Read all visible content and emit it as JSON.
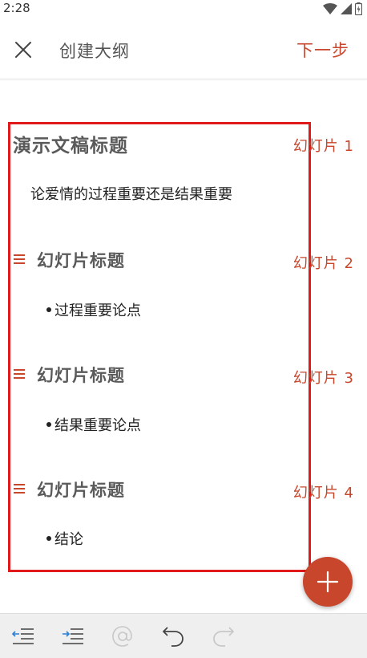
{
  "status_bar": {
    "time": "2:28"
  },
  "app_bar": {
    "title": "创建大纲",
    "next_label": "下一步",
    "close_icon": "close-icon"
  },
  "outline": {
    "presentation_title": "演示文稿标题",
    "presentation_subtitle": "论爱情的过程重要还是结果重要",
    "slides": [
      {
        "number_label": "幻灯片 1"
      },
      {
        "number_label": "幻灯片 2",
        "title": "幻灯片标题",
        "bullet": "过程重要论点"
      },
      {
        "number_label": "幻灯片 3",
        "title": "幻灯片标题",
        "bullet": "结果重要论点"
      },
      {
        "number_label": "幻灯片 4",
        "title": "幻灯片标题",
        "bullet": "结论"
      }
    ]
  },
  "fab": {
    "icon": "plus-icon"
  },
  "toolbar": {
    "items": [
      "outdent-icon",
      "indent-icon",
      "at-icon",
      "undo-icon",
      "redo-icon"
    ]
  },
  "colors": {
    "accent": "#c8472c",
    "highlight_frame": "#e01a1a",
    "toolbar_bg": "#efefef",
    "title_gray": "#5a5a5a"
  }
}
